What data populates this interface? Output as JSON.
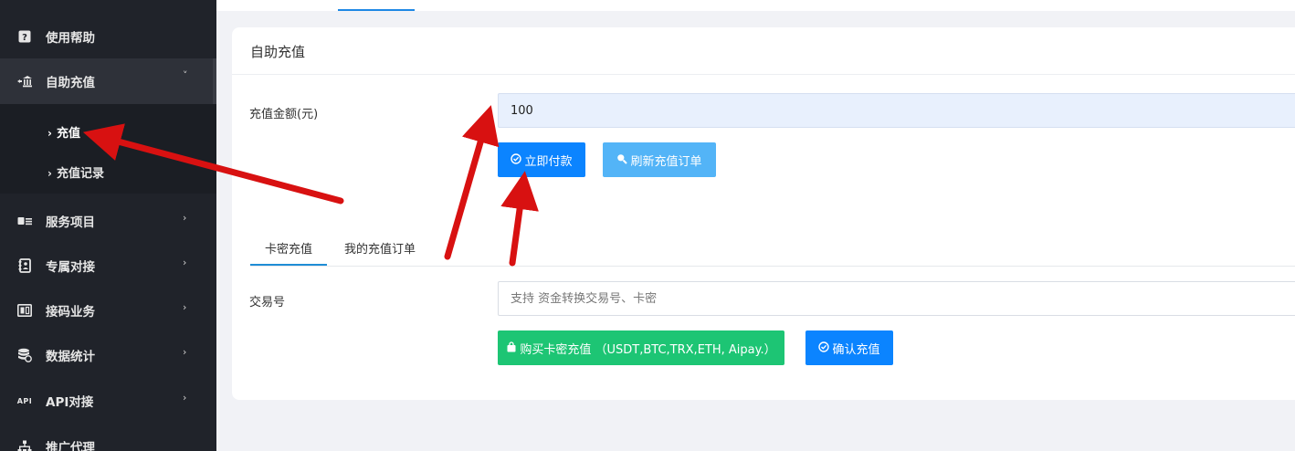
{
  "sidebar": {
    "items": [
      {
        "label": "使用帮助",
        "icon": "question-icon"
      },
      {
        "label": "自助充值",
        "icon": "bank-icon",
        "chevron": "˅"
      },
      {
        "label": "服务项目",
        "icon": "card-icon",
        "chevron": "›"
      },
      {
        "label": "专属对接",
        "icon": "contact-icon",
        "chevron": "›"
      },
      {
        "label": "接码业务",
        "icon": "sim-icon",
        "chevron": "›"
      },
      {
        "label": "数据统计",
        "icon": "database-icon",
        "chevron": "›"
      },
      {
        "label": "API对接",
        "icon": "api-icon",
        "icon_text": "API",
        "chevron": "›"
      },
      {
        "label": "推广代理",
        "icon": "sitemap-icon"
      }
    ],
    "sub_items": [
      {
        "label": "充值",
        "arrow": "›"
      },
      {
        "label": "充值记录",
        "arrow": "›"
      }
    ]
  },
  "card": {
    "title": "自助充值",
    "amount_label": "充值金额(元)",
    "amount_value": "100",
    "pay_button": "立即付款",
    "refresh_button": "刷新充值订单",
    "tabs": [
      "卡密充值",
      "我的充值订单"
    ],
    "txn_label": "交易号",
    "txn_placeholder": "支持 资金转换交易号、卡密",
    "buy_button": "购买卡密充值 （USDT,BTC,TRX,ETH, Aipay.）",
    "confirm_button": "确认充值"
  },
  "colors": {
    "sidebar_bg": "#20232a",
    "primary_blue": "#0b84ff",
    "light_blue": "#53b4f7",
    "green": "#1dc574",
    "annotation_red": "#d81111"
  }
}
